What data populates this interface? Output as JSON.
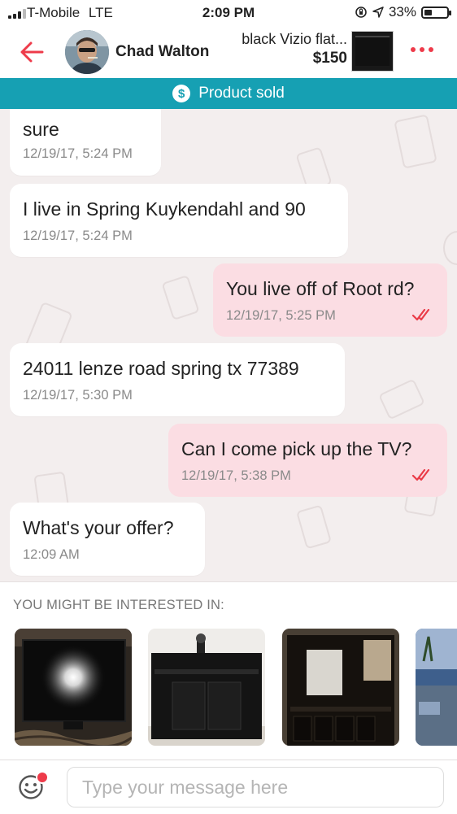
{
  "status_bar": {
    "carrier": "T-Mobile",
    "network": "LTE",
    "time": "2:09 PM",
    "battery": "33%",
    "battery_level": 0.33
  },
  "header": {
    "seller_name": "Chad Walton",
    "item_title": "black Vizio flat...",
    "item_price": "$150"
  },
  "banner": {
    "icon": "dollar-icon",
    "text": "Product sold",
    "color": "#16a0b3"
  },
  "messages": [
    {
      "direction": "in",
      "text": "sure",
      "time": "12/19/17, 5:24 PM"
    },
    {
      "direction": "in",
      "text": "I live in Spring Kuykendahl and 90",
      "time": "12/19/17, 5:24 PM"
    },
    {
      "direction": "out",
      "text": "You live off of Root rd?",
      "time": "12/19/17, 5:25 PM",
      "read": true
    },
    {
      "direction": "in",
      "text": "24011 lenze road spring tx 77389",
      "time": "12/19/17, 5:30 PM"
    },
    {
      "direction": "out",
      "text": "Can I come pick up the TV?",
      "time": "12/19/17, 5:38 PM",
      "read": true
    },
    {
      "direction": "in",
      "text": "What's your offer?",
      "time": "12:09 AM"
    }
  ],
  "recommendations": {
    "title": "YOU MIGHT BE INTERESTED IN:",
    "items": [
      {
        "icon": "monitor-photo"
      },
      {
        "icon": "tv-stand-photo"
      },
      {
        "icon": "entertainment-center-photo"
      },
      {
        "icon": "street-photo"
      }
    ]
  },
  "composer": {
    "placeholder": "Type your message here",
    "value": ""
  },
  "colors": {
    "accent": "#ee3b4a",
    "outgoing_bubble": "#fbdde3",
    "incoming_bubble": "#ffffff",
    "chat_background": "#f3eeee"
  }
}
